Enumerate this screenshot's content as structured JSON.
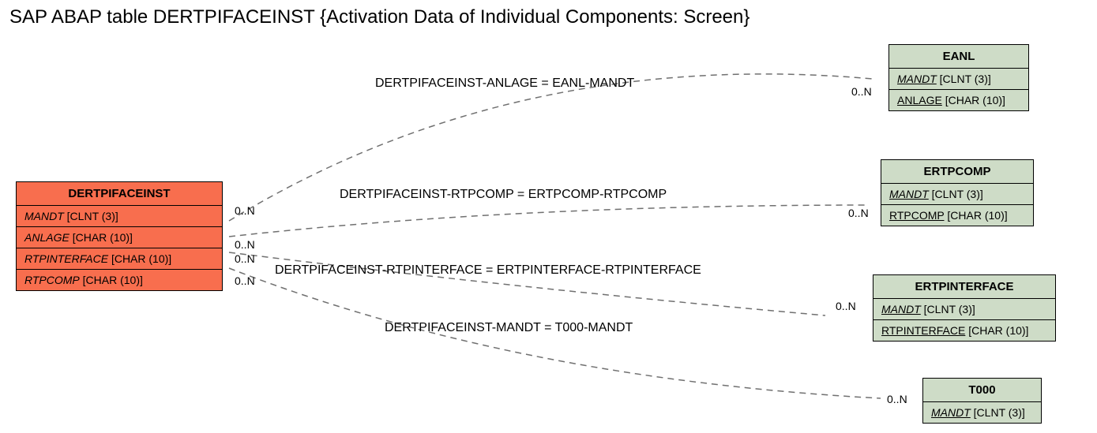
{
  "title": "SAP ABAP table DERTPIFACEINST {Activation Data of Individual Components: Screen}",
  "main_entity": {
    "name": "DERTPIFACEINST",
    "fields": [
      {
        "label": "MANDT",
        "type": "[CLNT (3)]"
      },
      {
        "label": "ANLAGE",
        "type": "[CHAR (10)]"
      },
      {
        "label": "RTPINTERFACE",
        "type": "[CHAR (10)]"
      },
      {
        "label": "RTPCOMP",
        "type": "[CHAR (10)]"
      }
    ]
  },
  "related_entities": [
    {
      "name": "EANL",
      "fields": [
        {
          "label": "MANDT",
          "type": "[CLNT (3)]",
          "underline": true
        },
        {
          "label": "ANLAGE",
          "type": "[CHAR (10)]",
          "underline": true
        }
      ]
    },
    {
      "name": "ERTPCOMP",
      "fields": [
        {
          "label": "MANDT",
          "type": "[CLNT (3)]",
          "underline": true
        },
        {
          "label": "RTPCOMP",
          "type": "[CHAR (10)]",
          "underline": true
        }
      ]
    },
    {
      "name": "ERTPINTERFACE",
      "fields": [
        {
          "label": "MANDT",
          "type": "[CLNT (3)]",
          "underline": true
        },
        {
          "label": "RTPINTERFACE",
          "type": "[CHAR (10)]",
          "underline": true
        }
      ]
    },
    {
      "name": "T000",
      "fields": [
        {
          "label": "MANDT",
          "type": "[CLNT (3)]",
          "underline": true
        }
      ]
    }
  ],
  "relationships": [
    {
      "text": "DERTPIFACEINST-ANLAGE = EANL-MANDT",
      "left_card": "0..N",
      "right_card": "0..N"
    },
    {
      "text": "DERTPIFACEINST-RTPCOMP = ERTPCOMP-RTPCOMP",
      "left_card": "0..N",
      "right_card": "0..N"
    },
    {
      "text": "DERTPIFACEINST-RTPINTERFACE = ERTPINTERFACE-RTPINTERFACE",
      "left_card": "0..N",
      "right_card": "0..N"
    },
    {
      "text": "DERTPIFACEINST-MANDT = T000-MANDT",
      "left_card": "0..N",
      "right_card": "0..N"
    }
  ]
}
